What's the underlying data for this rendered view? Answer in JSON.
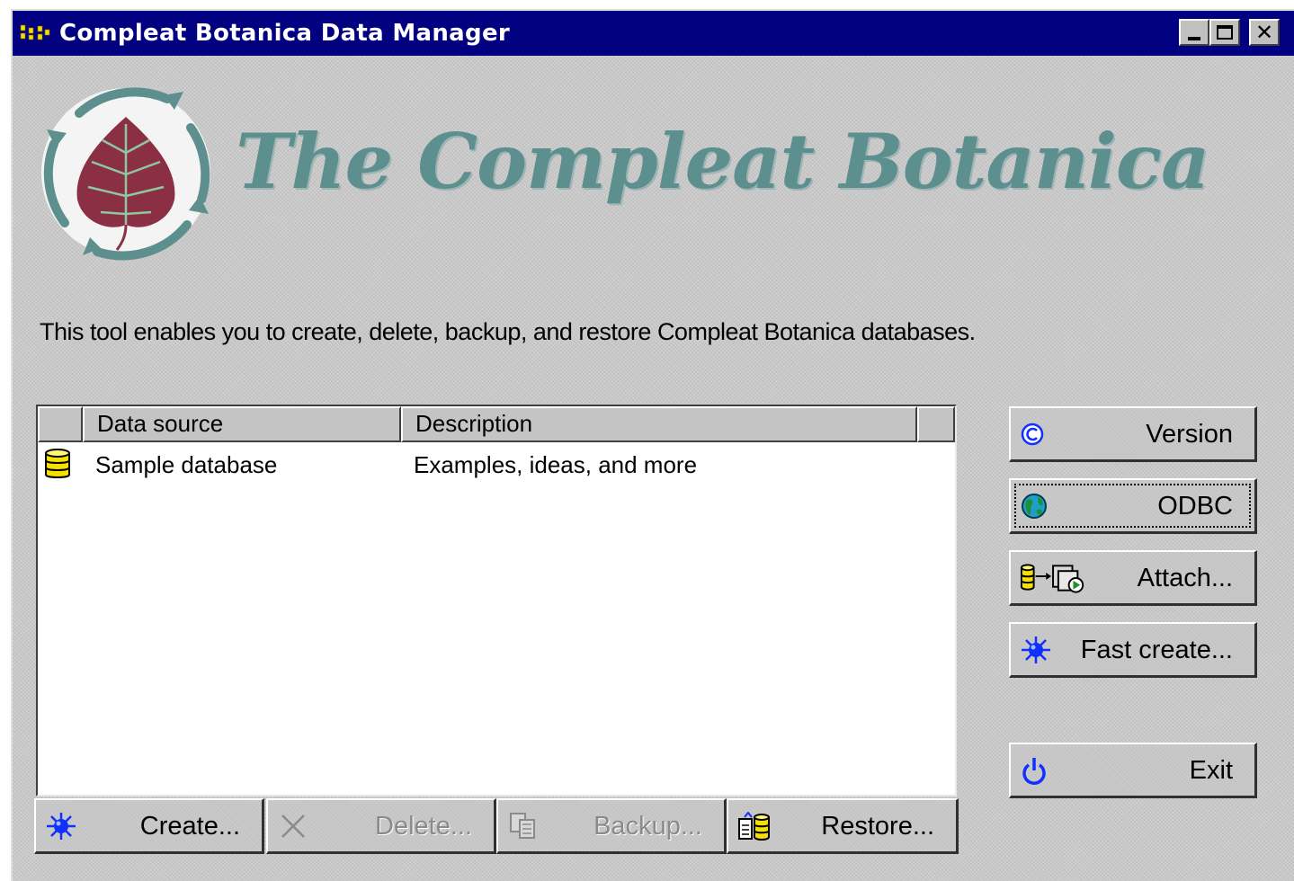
{
  "window": {
    "title": "Compleat Botanica Data Manager",
    "icon": "app-dots-icon",
    "controls": {
      "minimize_icon": "minimize-icon",
      "maximize_icon": "maximize-icon",
      "close_label": "✕"
    }
  },
  "brand": {
    "title": "The Compleat Botanica",
    "logo_icon": "leaf-cycle-logo-icon"
  },
  "intro_text": "This tool enables you to create, delete, backup, and restore Compleat Botanica databases.",
  "list": {
    "columns": [
      "",
      "Data source",
      "Description"
    ],
    "rows": [
      {
        "icon": "database-icon",
        "data_source": "Sample database",
        "description": "Examples, ideas, and more"
      }
    ]
  },
  "bottom_buttons": {
    "create": {
      "label": "Create...",
      "icon": "sparkle-icon",
      "enabled": true
    },
    "delete": {
      "label": "Delete...",
      "icon": "delete-x-icon",
      "enabled": false
    },
    "backup": {
      "label": "Backup...",
      "icon": "copy-pages-icon",
      "enabled": false
    },
    "restore": {
      "label": "Restore...",
      "icon": "restore-icon",
      "enabled": true
    }
  },
  "side_buttons": {
    "version": {
      "label": "Version",
      "icon": "copyright-icon"
    },
    "odbc": {
      "label": "ODBC",
      "icon": "globe-icon",
      "focused": true
    },
    "attach": {
      "label": "Attach...",
      "icon": "attach-database-icon"
    },
    "fast_create": {
      "label": "Fast create...",
      "icon": "sparkle-icon"
    },
    "exit": {
      "label": "Exit",
      "icon": "power-icon"
    }
  },
  "colors": {
    "titlebar": "#000080",
    "face": "#c8c8c8",
    "brand_teal": "#5d8f8e",
    "leaf_maroon": "#8b2f45",
    "database_yellow": "#f5e000"
  }
}
